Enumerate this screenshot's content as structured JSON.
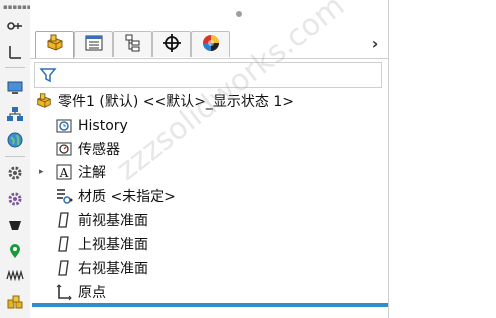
{
  "tree": {
    "root_label": "零件1 (默认) <<默认>_显示状态 1>",
    "items": [
      {
        "label": "History",
        "icon": "history-folder-icon"
      },
      {
        "label": "传感器",
        "icon": "sensors-icon"
      },
      {
        "label": "注解",
        "icon": "annotations-icon",
        "expandable": true
      },
      {
        "label": "材质 <未指定>",
        "icon": "material-icon"
      },
      {
        "label": "前视基准面",
        "icon": "plane-icon"
      },
      {
        "label": "上视基准面",
        "icon": "plane-icon"
      },
      {
        "label": "右视基准面",
        "icon": "plane-icon"
      },
      {
        "label": "原点",
        "icon": "origin-icon"
      }
    ]
  },
  "tabs": [
    {
      "name": "featuremanager-tab",
      "icon": "part-icon",
      "active": true
    },
    {
      "name": "propertymanager-tab",
      "icon": "property-list-icon"
    },
    {
      "name": "configurationmanager-tab",
      "icon": "configuration-icon"
    },
    {
      "name": "dimxpert-tab",
      "icon": "crosshair-icon"
    },
    {
      "name": "display-manager-tab",
      "icon": "appearance-sphere-icon"
    }
  ],
  "tabs_more_glyph": "›",
  "expander_glyph": "▸",
  "watermark": "zzzsolidworks.com",
  "colors": {
    "accent_bar": "#2f8ec9",
    "part_icon": "#e8a321"
  }
}
